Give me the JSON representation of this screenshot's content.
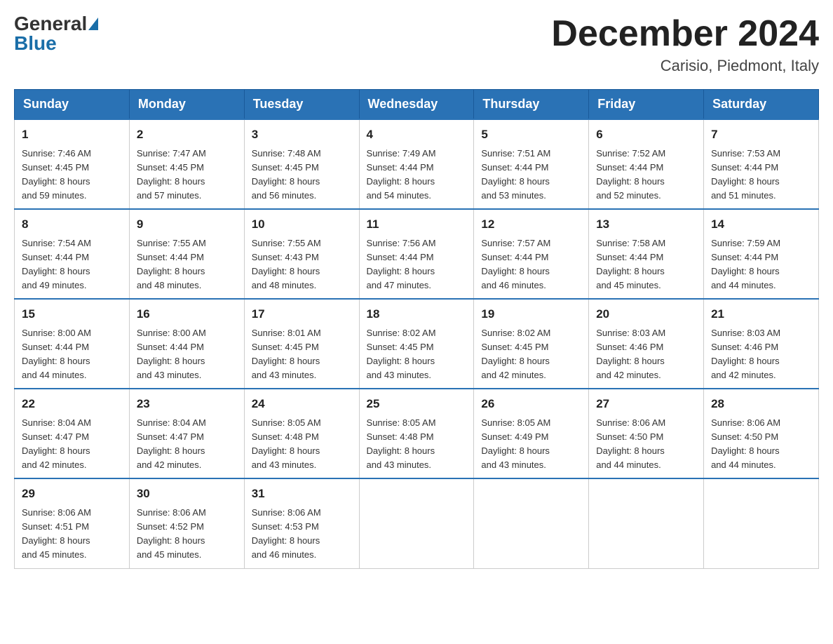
{
  "header": {
    "logo_general": "General",
    "logo_blue": "Blue",
    "month_title": "December 2024",
    "location": "Carisio, Piedmont, Italy"
  },
  "weekdays": [
    "Sunday",
    "Monday",
    "Tuesday",
    "Wednesday",
    "Thursday",
    "Friday",
    "Saturday"
  ],
  "weeks": [
    [
      {
        "day": "1",
        "sunrise": "7:46 AM",
        "sunset": "4:45 PM",
        "daylight": "8 hours and 59 minutes."
      },
      {
        "day": "2",
        "sunrise": "7:47 AM",
        "sunset": "4:45 PM",
        "daylight": "8 hours and 57 minutes."
      },
      {
        "day": "3",
        "sunrise": "7:48 AM",
        "sunset": "4:45 PM",
        "daylight": "8 hours and 56 minutes."
      },
      {
        "day": "4",
        "sunrise": "7:49 AM",
        "sunset": "4:44 PM",
        "daylight": "8 hours and 54 minutes."
      },
      {
        "day": "5",
        "sunrise": "7:51 AM",
        "sunset": "4:44 PM",
        "daylight": "8 hours and 53 minutes."
      },
      {
        "day": "6",
        "sunrise": "7:52 AM",
        "sunset": "4:44 PM",
        "daylight": "8 hours and 52 minutes."
      },
      {
        "day": "7",
        "sunrise": "7:53 AM",
        "sunset": "4:44 PM",
        "daylight": "8 hours and 51 minutes."
      }
    ],
    [
      {
        "day": "8",
        "sunrise": "7:54 AM",
        "sunset": "4:44 PM",
        "daylight": "8 hours and 49 minutes."
      },
      {
        "day": "9",
        "sunrise": "7:55 AM",
        "sunset": "4:44 PM",
        "daylight": "8 hours and 48 minutes."
      },
      {
        "day": "10",
        "sunrise": "7:55 AM",
        "sunset": "4:43 PM",
        "daylight": "8 hours and 48 minutes."
      },
      {
        "day": "11",
        "sunrise": "7:56 AM",
        "sunset": "4:44 PM",
        "daylight": "8 hours and 47 minutes."
      },
      {
        "day": "12",
        "sunrise": "7:57 AM",
        "sunset": "4:44 PM",
        "daylight": "8 hours and 46 minutes."
      },
      {
        "day": "13",
        "sunrise": "7:58 AM",
        "sunset": "4:44 PM",
        "daylight": "8 hours and 45 minutes."
      },
      {
        "day": "14",
        "sunrise": "7:59 AM",
        "sunset": "4:44 PM",
        "daylight": "8 hours and 44 minutes."
      }
    ],
    [
      {
        "day": "15",
        "sunrise": "8:00 AM",
        "sunset": "4:44 PM",
        "daylight": "8 hours and 44 minutes."
      },
      {
        "day": "16",
        "sunrise": "8:00 AM",
        "sunset": "4:44 PM",
        "daylight": "8 hours and 43 minutes."
      },
      {
        "day": "17",
        "sunrise": "8:01 AM",
        "sunset": "4:45 PM",
        "daylight": "8 hours and 43 minutes."
      },
      {
        "day": "18",
        "sunrise": "8:02 AM",
        "sunset": "4:45 PM",
        "daylight": "8 hours and 43 minutes."
      },
      {
        "day": "19",
        "sunrise": "8:02 AM",
        "sunset": "4:45 PM",
        "daylight": "8 hours and 42 minutes."
      },
      {
        "day": "20",
        "sunrise": "8:03 AM",
        "sunset": "4:46 PM",
        "daylight": "8 hours and 42 minutes."
      },
      {
        "day": "21",
        "sunrise": "8:03 AM",
        "sunset": "4:46 PM",
        "daylight": "8 hours and 42 minutes."
      }
    ],
    [
      {
        "day": "22",
        "sunrise": "8:04 AM",
        "sunset": "4:47 PM",
        "daylight": "8 hours and 42 minutes."
      },
      {
        "day": "23",
        "sunrise": "8:04 AM",
        "sunset": "4:47 PM",
        "daylight": "8 hours and 42 minutes."
      },
      {
        "day": "24",
        "sunrise": "8:05 AM",
        "sunset": "4:48 PM",
        "daylight": "8 hours and 43 minutes."
      },
      {
        "day": "25",
        "sunrise": "8:05 AM",
        "sunset": "4:48 PM",
        "daylight": "8 hours and 43 minutes."
      },
      {
        "day": "26",
        "sunrise": "8:05 AM",
        "sunset": "4:49 PM",
        "daylight": "8 hours and 43 minutes."
      },
      {
        "day": "27",
        "sunrise": "8:06 AM",
        "sunset": "4:50 PM",
        "daylight": "8 hours and 44 minutes."
      },
      {
        "day": "28",
        "sunrise": "8:06 AM",
        "sunset": "4:50 PM",
        "daylight": "8 hours and 44 minutes."
      }
    ],
    [
      {
        "day": "29",
        "sunrise": "8:06 AM",
        "sunset": "4:51 PM",
        "daylight": "8 hours and 45 minutes."
      },
      {
        "day": "30",
        "sunrise": "8:06 AM",
        "sunset": "4:52 PM",
        "daylight": "8 hours and 45 minutes."
      },
      {
        "day": "31",
        "sunrise": "8:06 AM",
        "sunset": "4:53 PM",
        "daylight": "8 hours and 46 minutes."
      },
      null,
      null,
      null,
      null
    ]
  ],
  "labels": {
    "sunrise": "Sunrise:",
    "sunset": "Sunset:",
    "daylight": "Daylight:"
  }
}
